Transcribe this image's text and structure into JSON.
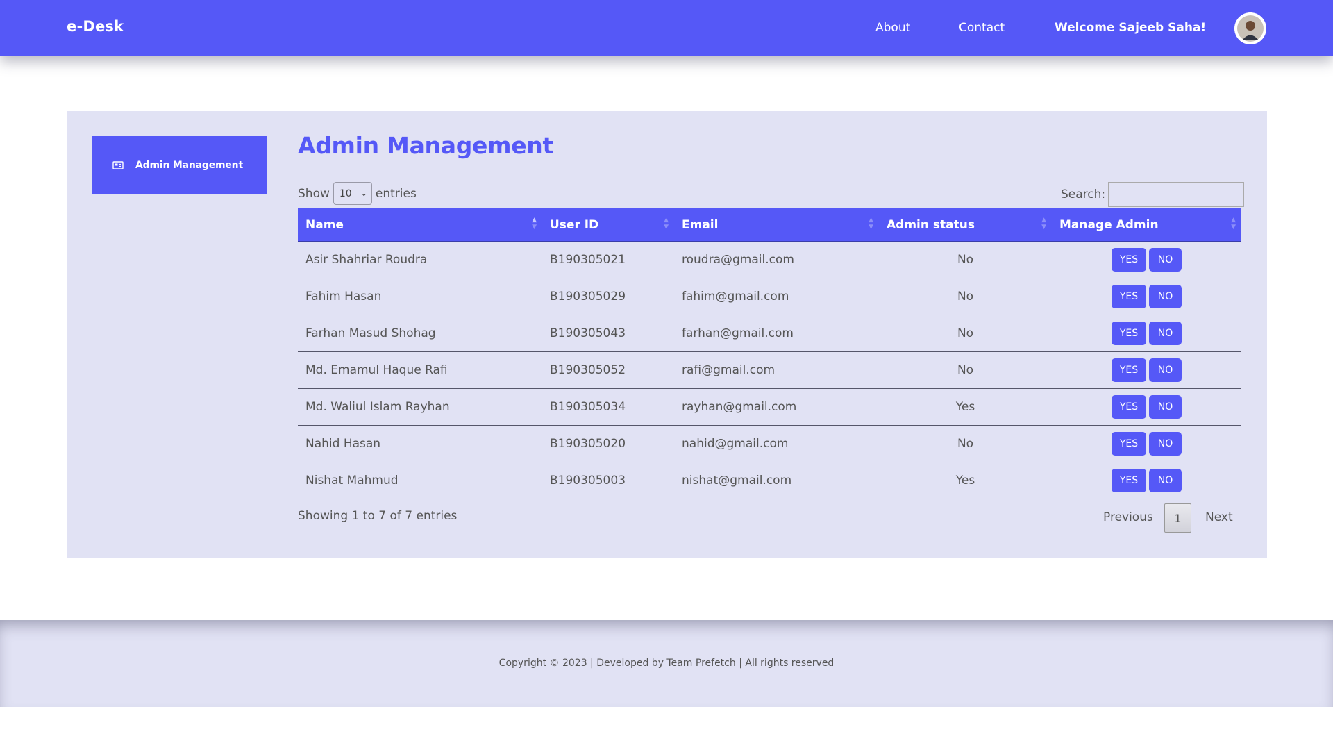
{
  "navbar": {
    "brand": "e-Desk",
    "links": [
      "About",
      "Contact"
    ],
    "welcome": "Welcome Sajeeb Saha!"
  },
  "sidebar": {
    "items": [
      {
        "label": "Admin Management",
        "icon": "id-card-icon"
      }
    ]
  },
  "main": {
    "title": "Admin Management",
    "length": {
      "prefix": "Show",
      "value": "10",
      "suffix": "entries"
    },
    "search": {
      "label": "Search:",
      "value": ""
    },
    "columns": [
      "Name",
      "User ID",
      "Email",
      "Admin status",
      "Manage Admin"
    ],
    "rows": [
      {
        "name": "Asir Shahriar Roudra",
        "user_id": "B190305021",
        "email": "roudra@gmail.com",
        "status": "No"
      },
      {
        "name": "Fahim Hasan",
        "user_id": "B190305029",
        "email": "fahim@gmail.com",
        "status": "No"
      },
      {
        "name": "Farhan Masud Shohag",
        "user_id": "B190305043",
        "email": "farhan@gmail.com",
        "status": "No"
      },
      {
        "name": "Md. Emamul Haque Rafi",
        "user_id": "B190305052",
        "email": "rafi@gmail.com",
        "status": "No"
      },
      {
        "name": "Md. Waliul Islam Rayhan",
        "user_id": "B190305034",
        "email": "rayhan@gmail.com",
        "status": "Yes"
      },
      {
        "name": "Nahid Hasan",
        "user_id": "B190305020",
        "email": "nahid@gmail.com",
        "status": "No"
      },
      {
        "name": "Nishat Mahmud",
        "user_id": "B190305003",
        "email": "nishat@gmail.com",
        "status": "Yes"
      }
    ],
    "action_labels": {
      "yes": "YES",
      "no": "NO"
    },
    "info": "Showing 1 to 7 of 7 entries",
    "pagination": {
      "previous": "Previous",
      "current": "1",
      "next": "Next"
    }
  },
  "footer": {
    "copyright": "Copyright © 2023 | Developed by Team Prefetch | All rights reserved"
  },
  "colors": {
    "accent": "#5558f7",
    "panel_bg": "#e1e2f4",
    "text": "#555555"
  }
}
